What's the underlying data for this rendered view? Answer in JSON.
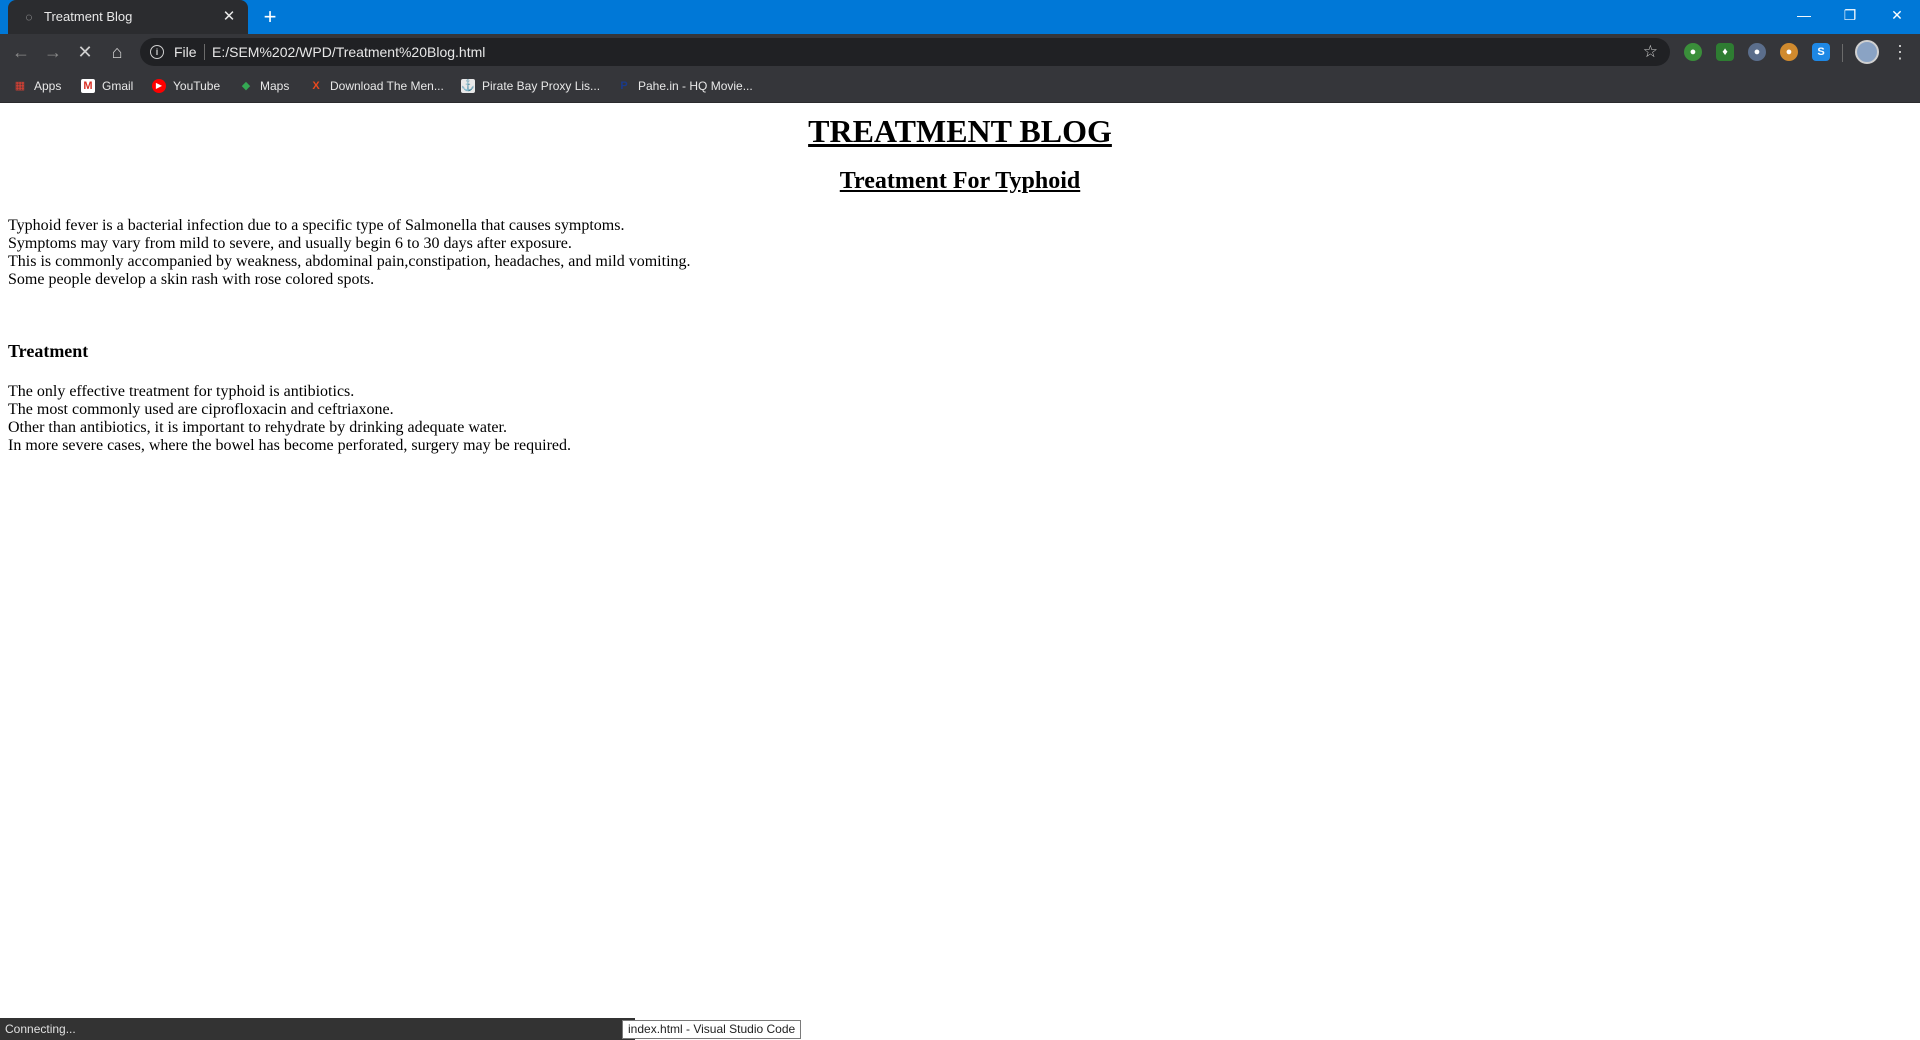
{
  "tab": {
    "title": "Treatment Blog",
    "close": "✕",
    "new_tab": "+"
  },
  "window": {
    "minimize": "—",
    "restore": "❐",
    "close": "✕"
  },
  "toolbar": {
    "back": "←",
    "forward": "→",
    "stop": "✕",
    "home": "⌂",
    "scheme": "File",
    "url": "E:/SEM%202/WPD/Treatment%20Blog.html",
    "star": "☆",
    "menu": "⋮"
  },
  "bookmarks": [
    {
      "label": "Apps",
      "icon": "apps-grid-icon",
      "glyph": "▦",
      "color": "#e34133"
    },
    {
      "label": "Gmail",
      "icon": "gmail-icon",
      "glyph": "M",
      "color": "#d93025"
    },
    {
      "label": "YouTube",
      "icon": "youtube-icon",
      "glyph": "▶",
      "color": "#ff0000"
    },
    {
      "label": "Maps",
      "icon": "maps-icon",
      "glyph": "◆",
      "color": "#34a853"
    },
    {
      "label": "Download The Men...",
      "icon": "x-logo-icon",
      "glyph": "X",
      "color": "#e8491d"
    },
    {
      "label": "Pirate Bay Proxy Lis...",
      "icon": "pirate-ship-icon",
      "glyph": "⚓",
      "color": "#d0d0d0"
    },
    {
      "label": "Pahe.in - HQ Movie...",
      "icon": "pahe-icon",
      "glyph": "P",
      "color": "#1a3a8a"
    }
  ],
  "page": {
    "title": "TREATMENT BLOG",
    "subtitle": "Treatment For Typhoid",
    "intro": [
      "Typhoid fever is a bacterial infection due to a specific type of Salmonella that causes symptoms.",
      "Symptoms may vary from mild to severe, and usually begin 6 to 30 days after exposure.",
      "This is commonly accompanied by weakness, abdominal pain,constipation, headaches, and mild vomiting.",
      "Some people develop a skin rash with rose colored spots."
    ],
    "treatment_heading": "Treatment",
    "treatment": [
      "The only effective treatment for typhoid is antibiotics.",
      "The most commonly used are ciprofloxacin and ceftriaxone.",
      "Other than antibiotics, it is important to rehydrate by drinking adequate water.",
      "In more severe cases, where the bowel has become perforated, surgery may be required."
    ]
  },
  "status": {
    "text": "Connecting...",
    "tooltip": "index.html - Visual Studio Code"
  }
}
